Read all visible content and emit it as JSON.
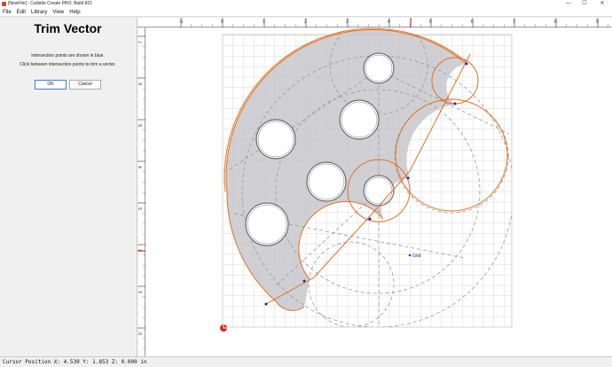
{
  "window": {
    "title": "[NewFile] - Carbide Create PRO: Build 821",
    "minimize": "—",
    "maximize": "☐",
    "close": "✕"
  },
  "menu": [
    "File",
    "Edit",
    "Library",
    "View",
    "Help"
  ],
  "panel": {
    "title": "Trim Vector",
    "line1": "Intersection points are shown in blue.",
    "line2": "Click between intersection points to trim a vector.",
    "ok_label": "OK",
    "cancel_label": "Cancel"
  },
  "ruler": {
    "top_labels": [
      "-1",
      "0",
      "1",
      "2",
      "3",
      "4",
      "5",
      "6",
      "7",
      "8",
      "9"
    ],
    "left_labels": [
      "7",
      "6",
      "5",
      "4",
      "3",
      "2",
      "1",
      "0"
    ]
  },
  "canvas": {
    "grid_label": "Grid",
    "colors": {
      "selected": "#e07020",
      "vector": "#444444",
      "dashed": "#999999",
      "intersection": "#2020c0",
      "shaded": "#c8c8cc"
    }
  },
  "status": {
    "text": "Cursor Position X: 4.530 Y: 1.853 Z: 0.000 in"
  }
}
